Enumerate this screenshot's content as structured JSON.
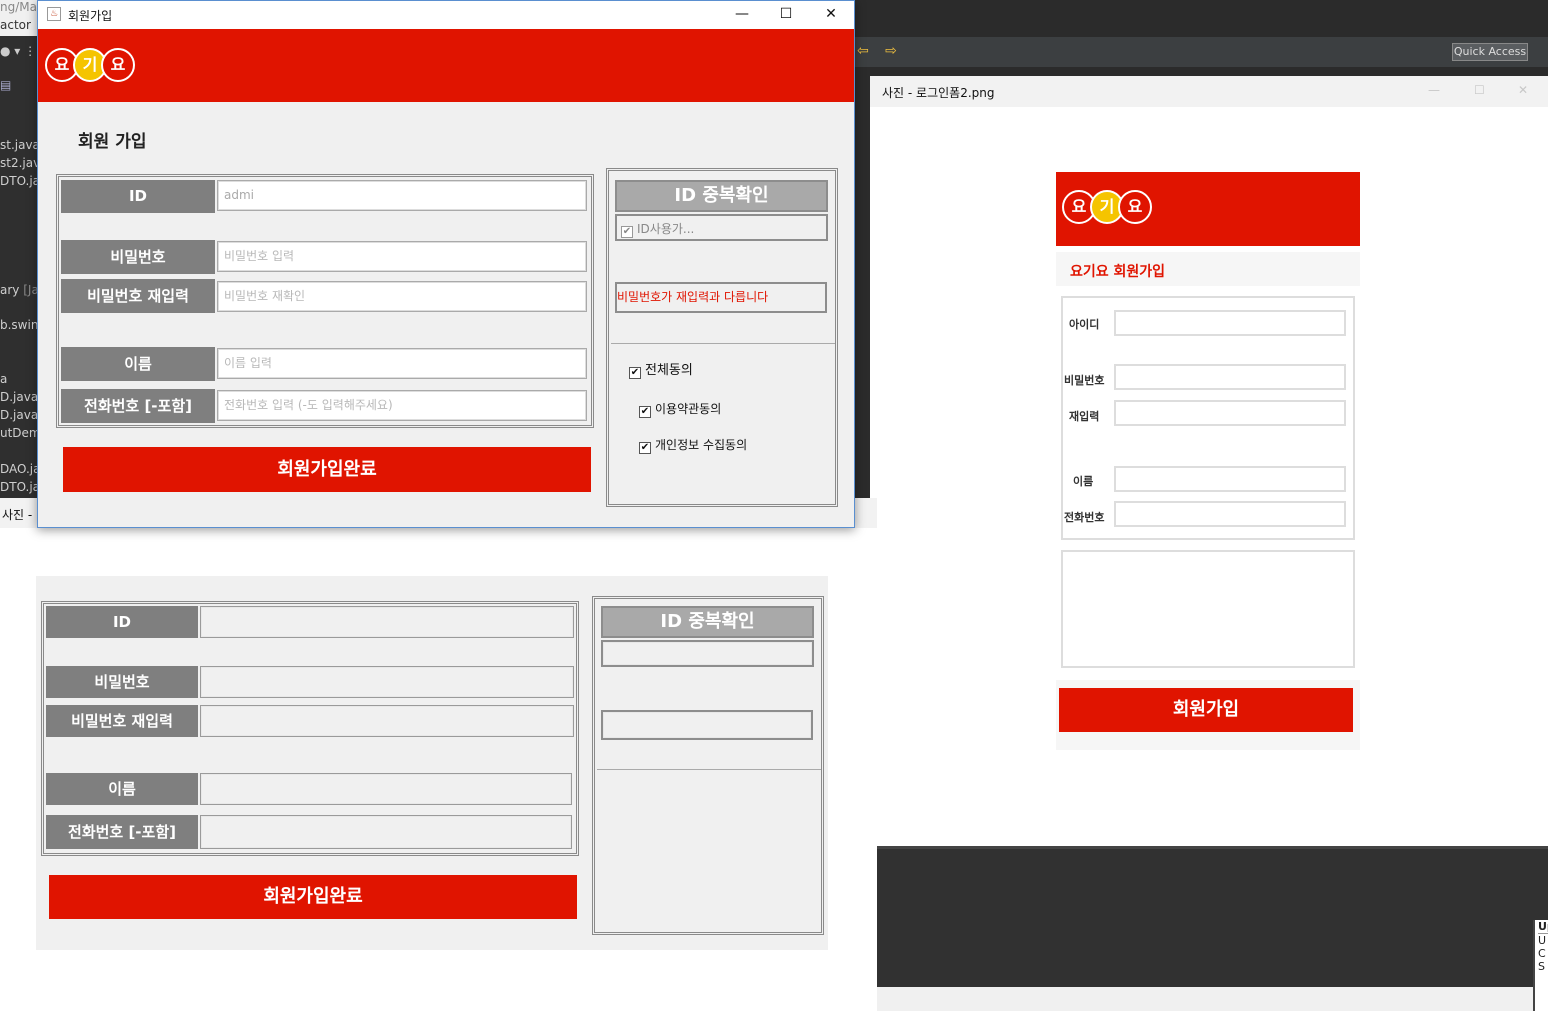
{
  "ide": {
    "partial_lines": [
      "ng/Ma",
      "actor",
      "st.java",
      "st2.java",
      "DTO.jav",
      "ary",
      "[Jav",
      "b.swin",
      "a",
      "D.java",
      "D.java",
      "utDem",
      "DAO.jav",
      "DTO.jav"
    ],
    "quick_access": "Quick Access",
    "up_panel_lines": [
      "Up",
      "U",
      "C",
      "S"
    ]
  },
  "main_window": {
    "title": "회원가입",
    "controls": {
      "minimize": "—",
      "maximize": "☐",
      "close": "✕"
    },
    "logo_letters": [
      "요",
      "기",
      "요"
    ],
    "heading": "회원 가입",
    "fields": [
      {
        "label": "ID",
        "value": "admi",
        "placeholder": ""
      },
      {
        "label": "비밀번호",
        "value": "",
        "placeholder": "비밀번호 입력"
      },
      {
        "label": "비밀번호 재입력",
        "value": "",
        "placeholder": "비밀번호 재확인"
      },
      {
        "label": "이름",
        "value": "",
        "placeholder": "이름 입력"
      },
      {
        "label": "전화번호 [-포함]",
        "value": "",
        "placeholder": "전화번호 입력 (-도 입력해주세요)"
      }
    ],
    "id_check_button": "ID 중복확인",
    "id_status": "ID사용가...",
    "password_mismatch": "비밀번호가 재입력과 다릅니다",
    "agree_all": "전체동의",
    "agree_terms": "이용약관동의",
    "agree_privacy": "개인정보 수집동의",
    "submit_button": "회원가입완료"
  },
  "photo_viewer_bottom": {
    "title": "사진 -",
    "fields": [
      "ID",
      "비밀번호",
      "비밀번호 재입력",
      "이름",
      "전화번호 [-포함]"
    ],
    "id_check_button": "ID 중복확인",
    "submit_button": "회원가입완료"
  },
  "photo_viewer_right": {
    "title": "사진 - 로그인폼2.png",
    "controls": {
      "minimize": "—",
      "maximize": "☐",
      "close": "✕"
    },
    "logo_letters": [
      "요",
      "기",
      "요"
    ],
    "subtitle": "요기요 회원가입",
    "fields": [
      "아이디",
      "비밀번호",
      "재입력",
      "이름",
      "전화번호"
    ],
    "submit_button": "회원가입"
  },
  "colors": {
    "brand_red": "#e01400",
    "logo_yellow": "#f5c400",
    "label_gray": "#7f7f7f"
  }
}
